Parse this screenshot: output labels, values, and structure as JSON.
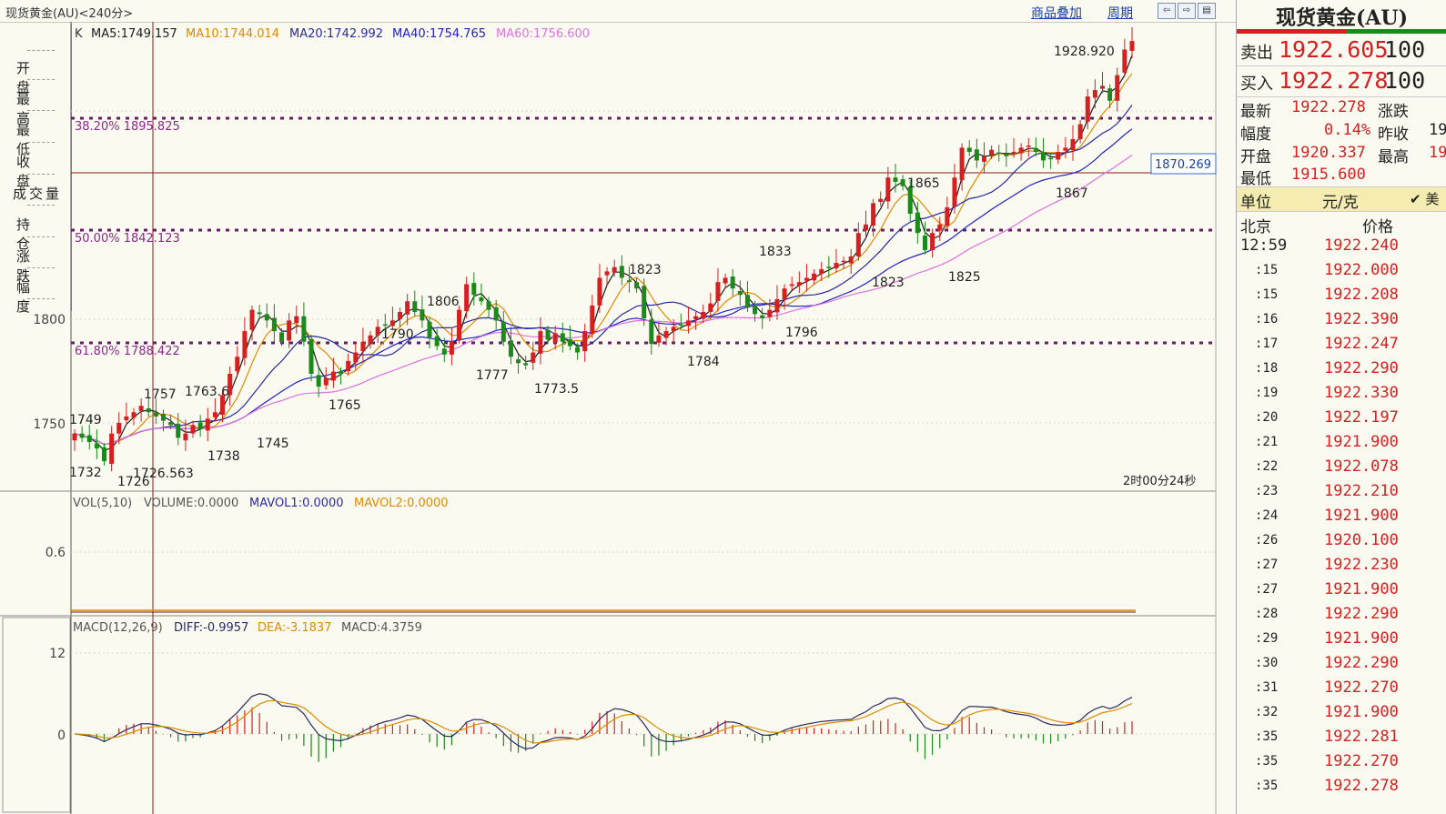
{
  "app": {
    "title": "现货黄金(AU)<240分>",
    "links": [
      "商品叠加",
      "周期"
    ],
    "nav_icons": [
      "arrow-left-icon",
      "arrow-right-icon",
      "layout-icon"
    ]
  },
  "info_labels": [
    "开 盘",
    "最 高",
    "最 低",
    "收 盘",
    "成交量",
    "持 仓",
    "涨 跌",
    "幅 度"
  ],
  "ma_legend": [
    {
      "label": "K",
      "color": "#333333"
    },
    {
      "label": "MA5:1749.157",
      "color": "#1a1a1a"
    },
    {
      "label": "MA10:1744.014",
      "color": "#e08a00"
    },
    {
      "label": "MA20:1742.992",
      "color": "#2a2aa0"
    },
    {
      "label": "MA40:1754.765",
      "color": "#2020c0"
    },
    {
      "label": "MA60:1756.600",
      "color": "#e070e0"
    }
  ],
  "y_axis_labels": [
    "1800",
    "1750"
  ],
  "fib_levels": [
    {
      "label": "38.20% 1895.825",
      "value": 1895.825
    },
    {
      "label": "50.00% 1842.123",
      "value": 1842.123
    },
    {
      "label": "61.80% 1788.422",
      "value": 1788.422
    }
  ],
  "crosshair_price": "1870.269",
  "price_annotations": [
    "1928.920",
    "1865",
    "1867",
    "1833",
    "1823",
    "1825",
    "1823",
    "1806",
    "1796",
    "1790",
    "1784",
    "1777",
    "1773.5",
    "1765",
    "1763.6",
    "1757",
    "1749",
    "1745",
    "1738",
    "1732",
    "1726",
    "1726.563"
  ],
  "timer": "2时00分24秒",
  "volume_legend": [
    {
      "label": "VOL(5,10)",
      "color": "#555555"
    },
    {
      "label": "VOLUME:0.0000",
      "color": "#555555"
    },
    {
      "label": "MAVOL1:0.0000",
      "color": "#2a2aa0"
    },
    {
      "label": "MAVOL2:0.0000",
      "color": "#e08a00"
    }
  ],
  "volume_axis": [
    "0.6"
  ],
  "macd_legend": [
    {
      "label": "MACD(12,26,9)",
      "color": "#555555"
    },
    {
      "label": "DIFF:-0.9957",
      "color": "#2a2a60"
    },
    {
      "label": "DEA:-3.1837",
      "color": "#e08a00"
    },
    {
      "label": "MACD:4.3759",
      "color": "#555555"
    }
  ],
  "macd_axis": [
    "12",
    "0"
  ],
  "quote_panel": {
    "title": "现货黄金(AU)",
    "sell_label": "卖出",
    "sell_price": "1922.605",
    "sell_vol": "100",
    "buy_label": "买入",
    "buy_price": "1922.278",
    "buy_vol": "100",
    "stats": [
      {
        "label": "最新",
        "value": "1922.278",
        "label2": "涨跌",
        "value2": ""
      },
      {
        "label": "幅度",
        "value": "0.14%",
        "label2": "昨收",
        "value2": "19"
      },
      {
        "label": "开盘",
        "value": "1920.337",
        "label2": "最高",
        "value2": "19"
      },
      {
        "label": "最低",
        "value": "1915.600",
        "label2": "",
        "value2": ""
      }
    ],
    "unit_label": "单位",
    "unit_value": "元/克",
    "unit_check": "✔ 美",
    "tick_header_city": "北京",
    "tick_header_price": "价格",
    "ticks": [
      {
        "time": "12:59",
        "price": "1922.240"
      },
      {
        "time": ":15",
        "price": "1922.000"
      },
      {
        "time": ":15",
        "price": "1922.208"
      },
      {
        "time": ":16",
        "price": "1922.390"
      },
      {
        "time": ":17",
        "price": "1922.247"
      },
      {
        "time": ":18",
        "price": "1922.290"
      },
      {
        "time": ":19",
        "price": "1922.330"
      },
      {
        "time": ":20",
        "price": "1922.197"
      },
      {
        "time": ":21",
        "price": "1921.900"
      },
      {
        "time": ":22",
        "price": "1922.078"
      },
      {
        "time": ":23",
        "price": "1922.210"
      },
      {
        "time": ":24",
        "price": "1921.900"
      },
      {
        "time": ":26",
        "price": "1920.100"
      },
      {
        "time": ":27",
        "price": "1922.230"
      },
      {
        "time": ":27",
        "price": "1921.900"
      },
      {
        "time": ":28",
        "price": "1922.290"
      },
      {
        "time": ":29",
        "price": "1921.900"
      },
      {
        "time": ":30",
        "price": "1922.290"
      },
      {
        "time": ":31",
        "price": "1922.270"
      },
      {
        "time": ":32",
        "price": "1921.900"
      },
      {
        "time": ":35",
        "price": "1922.281"
      },
      {
        "time": ":35",
        "price": "1922.270"
      },
      {
        "time": ":35",
        "price": "1922.278"
      }
    ]
  },
  "colors": {
    "up": "#d42020",
    "down": "#1a8a1a",
    "fib": "#6a1a6a",
    "crosshair": "#8a1a1a",
    "grid": "#d8d8c8"
  },
  "chart_data": {
    "type": "candlestick",
    "yrange": [
      1715,
      1935
    ],
    "close_path": [
      1742,
      1740,
      1738,
      1735,
      1729,
      1742,
      1747,
      1750,
      1752,
      1755,
      1752,
      1750,
      1748,
      1746,
      1740,
      1742,
      1746,
      1744,
      1749,
      1752,
      1760,
      1770,
      1778,
      1790,
      1800,
      1798,
      1795,
      1790,
      1785,
      1795,
      1797,
      1785,
      1770,
      1764,
      1768,
      1771,
      1770,
      1776,
      1780,
      1785,
      1788,
      1792,
      1793,
      1795,
      1799,
      1804,
      1799,
      1795,
      1787,
      1783,
      1779,
      1785,
      1800,
      1812,
      1807,
      1804,
      1800,
      1795,
      1785,
      1778,
      1775,
      1774,
      1780,
      1790,
      1786,
      1789,
      1785,
      1783,
      1780,
      1790,
      1802,
      1815,
      1818,
      1820,
      1815,
      1813,
      1810,
      1796,
      1784,
      1788,
      1790,
      1792,
      1793,
      1795,
      1797,
      1799,
      1803,
      1813,
      1815,
      1810,
      1807,
      1801,
      1798,
      1796,
      1800,
      1805,
      1810,
      1812,
      1813,
      1815,
      1817,
      1819,
      1820,
      1822,
      1823,
      1825,
      1836,
      1840,
      1850,
      1852,
      1862,
      1860,
      1858,
      1845,
      1836,
      1828,
      1836,
      1840,
      1848,
      1862,
      1876,
      1874,
      1870,
      1872,
      1875,
      1873,
      1872,
      1874,
      1876,
      1877,
      1874,
      1870,
      1871,
      1874,
      1876,
      1880,
      1887,
      1900,
      1903,
      1905,
      1898,
      1910,
      1922,
      1926
    ]
  }
}
